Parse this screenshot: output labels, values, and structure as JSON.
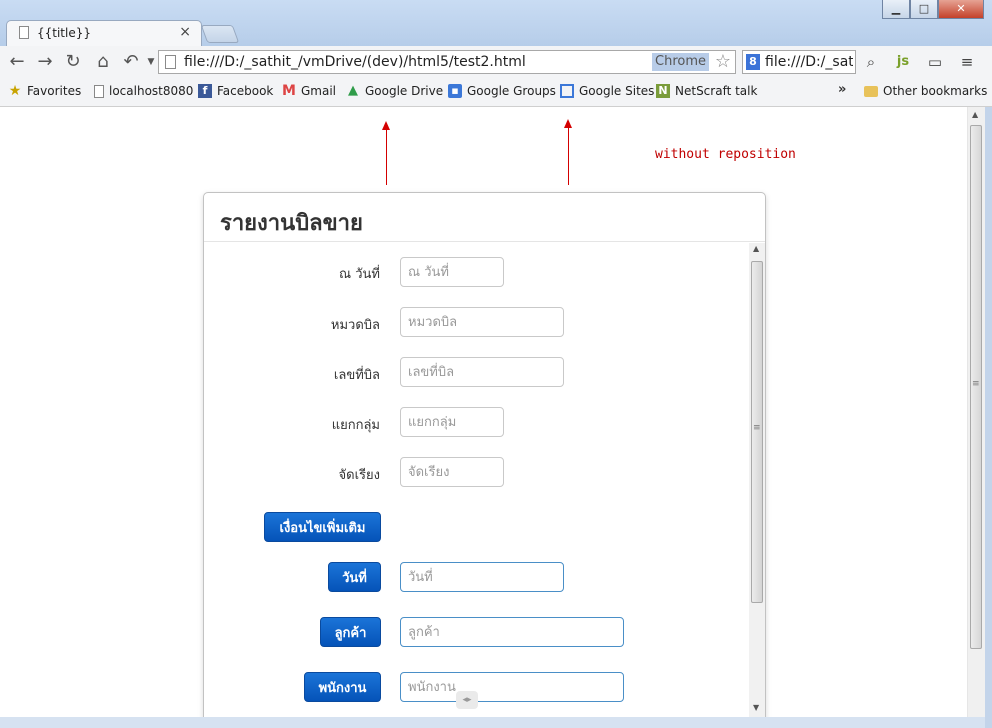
{
  "browser": {
    "tab_title": "{{title}}",
    "tab_close": "×",
    "url": "file:///D:/_sathit_/vmDrive/(dev)/html5/test2.html",
    "omnibox_badge": "Chrome",
    "search_text": "file:///D:/_sat",
    "window_controls": {
      "minimize": "▁",
      "maximize": "□",
      "close": "✕"
    }
  },
  "bookmarks": {
    "items": [
      {
        "label": "Favorites",
        "icon": "star-icon"
      },
      {
        "label": "localhost8080",
        "icon": "page-icon"
      },
      {
        "label": "Facebook",
        "icon": "facebook-icon"
      },
      {
        "label": "Gmail",
        "icon": "gmail-icon"
      },
      {
        "label": "Google Drive",
        "icon": "google-drive-icon"
      },
      {
        "label": "Google Groups",
        "icon": "google-groups-icon"
      },
      {
        "label": "Google Sites",
        "icon": "google-sites-icon"
      },
      {
        "label": "NetScraft talk",
        "icon": "netscraft-icon"
      }
    ],
    "more": "»",
    "other": "Other bookmarks"
  },
  "annotation": {
    "text": "without reposition",
    "color": "#d40000"
  },
  "dialog": {
    "title": "รายงานบิลขาย",
    "fields": [
      {
        "label": "ณ วันที่",
        "placeholder": "ณ วันที่"
      },
      {
        "label": "หมวดบิล",
        "placeholder": "หมวดบิล"
      },
      {
        "label": "เลขที่บิล",
        "placeholder": "เลขที่บิล"
      },
      {
        "label": "แยกกลุ่ม",
        "placeholder": "แยกกลุ่ม"
      },
      {
        "label": "จัดเรียง",
        "placeholder": "จัดเรียง"
      }
    ],
    "more_conditions_button": "เงื่อนไขเพิ่มเติม",
    "button_fields": [
      {
        "button": "วันที่",
        "placeholder": "วันที่"
      },
      {
        "button": "ลูกค้า",
        "placeholder": "ลูกค้า"
      },
      {
        "button": "พนักงาน",
        "placeholder": "พนักงาน"
      }
    ],
    "primary_color": "#0a5fc8"
  }
}
